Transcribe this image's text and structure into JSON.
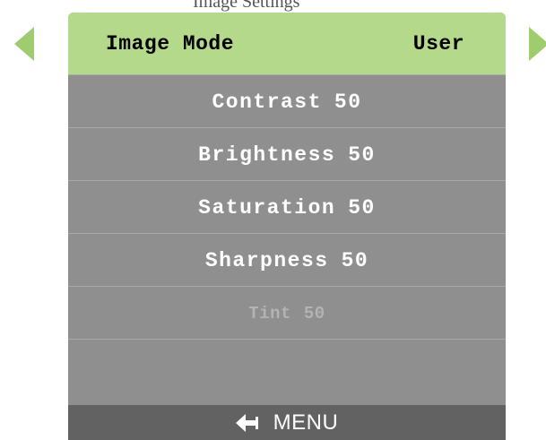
{
  "top_clip_text": "Image Settings",
  "nav": {
    "left_arrow_icon": "left-triangle-icon",
    "right_arrow_icon": "right-triangle-icon",
    "accent_color": "#9fcc6e"
  },
  "header": {
    "label": "Image Mode",
    "value": "User",
    "background": "#b4d98a"
  },
  "settings": [
    {
      "name": "Contrast",
      "value": "50",
      "enabled": true
    },
    {
      "name": "Brightness",
      "value": "50",
      "enabled": true
    },
    {
      "name": "Saturation",
      "value": "50",
      "enabled": true
    },
    {
      "name": "Sharpness",
      "value": "50",
      "enabled": true
    },
    {
      "name": "Tint",
      "value": "50",
      "enabled": false
    }
  ],
  "footer": {
    "icon": "back-arrow-icon",
    "label": "MENU"
  },
  "colors": {
    "panel": "#8f8f8f",
    "footer": "#626262",
    "text": "#ffffff",
    "disabled_text": "#b3b3b3"
  }
}
